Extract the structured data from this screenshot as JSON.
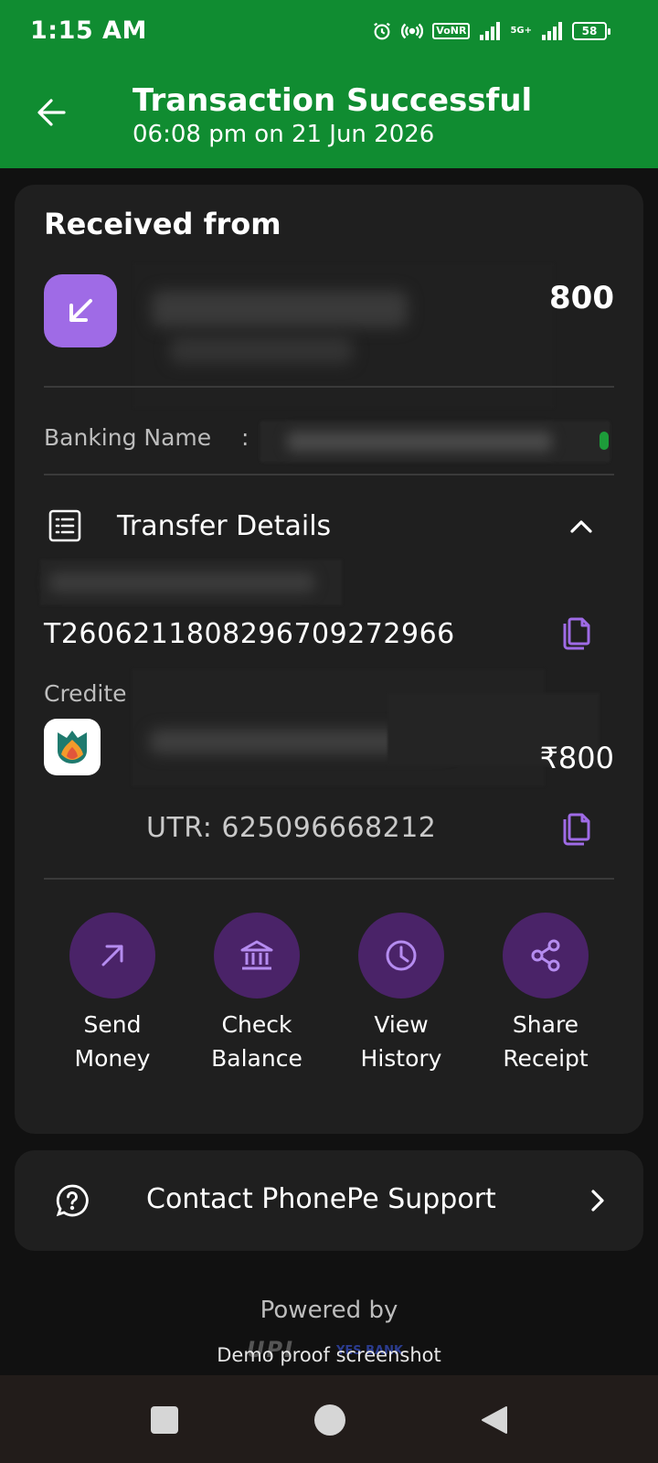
{
  "status_bar": {
    "time": "1:15 AM",
    "vonr_label": "VoNR",
    "network_label": "5G+",
    "battery_level": "58",
    "icons": [
      "alarm-icon",
      "hotspot-icon",
      "signal-icon",
      "signal-icon",
      "battery-icon"
    ]
  },
  "header": {
    "title": "Transaction Successful",
    "subtitle": "06:08 pm on 21 Jun 2026",
    "back_icon": "arrow-left-icon",
    "color": "#108c31"
  },
  "received": {
    "label": "Received from",
    "amount": "800",
    "icon": "arrow-down-left-icon",
    "icon_color": "#9f6be6"
  },
  "banking": {
    "label": "Banking Name",
    "colon": ":"
  },
  "transfer": {
    "label": "Transfer Details",
    "transaction_id": "T2606211808296709272966",
    "credited_label": "Credite",
    "credited_amount": "₹800",
    "utr": "UTR: 625096668212"
  },
  "actions": [
    {
      "label_line1": "Send",
      "label_line2": "Money",
      "icon": "arrow-up-right-icon"
    },
    {
      "label_line1": "Check",
      "label_line2": "Balance",
      "icon": "bank-icon"
    },
    {
      "label_line1": "View",
      "label_line2": "History",
      "icon": "clock-icon"
    },
    {
      "label_line1": "Share",
      "label_line2": "Receipt",
      "icon": "share-icon"
    }
  ],
  "support": {
    "label": "Contact PhonePe Support",
    "icon": "help-chat-icon"
  },
  "footer": {
    "powered_by": "Powered by",
    "watermark": "Demo proof screenshot",
    "upi_logo": "UPI",
    "bank_logo": "YES BANK"
  },
  "colors": {
    "accent_purple": "#9f6be6",
    "action_bg": "#4a2368",
    "card_bg": "#1f1f1f"
  }
}
